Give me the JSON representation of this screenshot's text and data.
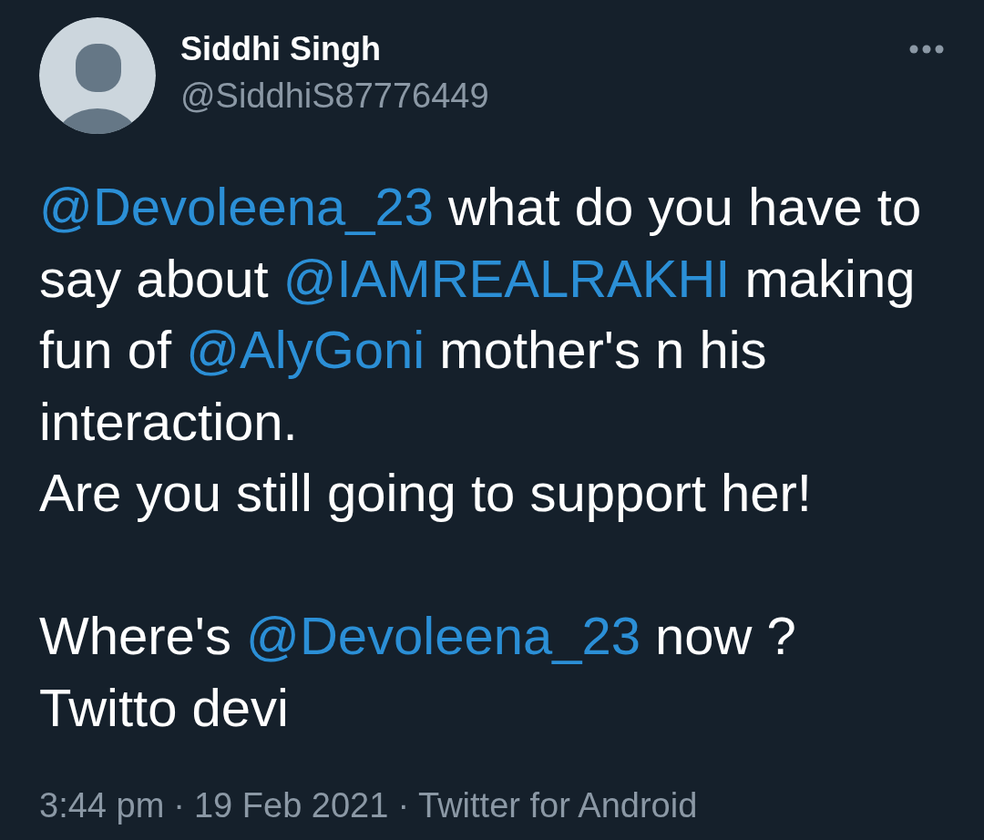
{
  "author": {
    "name": "Siddhi Singh",
    "handle": "@SiddhiS87776449"
  },
  "tweet": [
    {
      "kind": "mention",
      "text": "@Devoleena_23"
    },
    {
      "kind": "text",
      "text": " what do you have to say about "
    },
    {
      "kind": "mention",
      "text": "@IAMREALRAKHI"
    },
    {
      "kind": "text",
      "text": " making fun of "
    },
    {
      "kind": "mention",
      "text": "@AlyGoni"
    },
    {
      "kind": "text",
      "text": " mother's n his interaction.\nAre you still going to support her!\n\nWhere's "
    },
    {
      "kind": "mention",
      "text": "@Devoleena_23"
    },
    {
      "kind": "text",
      "text": " now ?\nTwitto devi"
    }
  ],
  "footer": [
    {
      "kind": "time",
      "text": "3:44 pm"
    },
    {
      "kind": "separator",
      "text": "·"
    },
    {
      "kind": "date",
      "text": "19 Feb 2021"
    },
    {
      "kind": "separator",
      "text": "·"
    },
    {
      "kind": "source",
      "text": "Twitter for Android"
    }
  ]
}
